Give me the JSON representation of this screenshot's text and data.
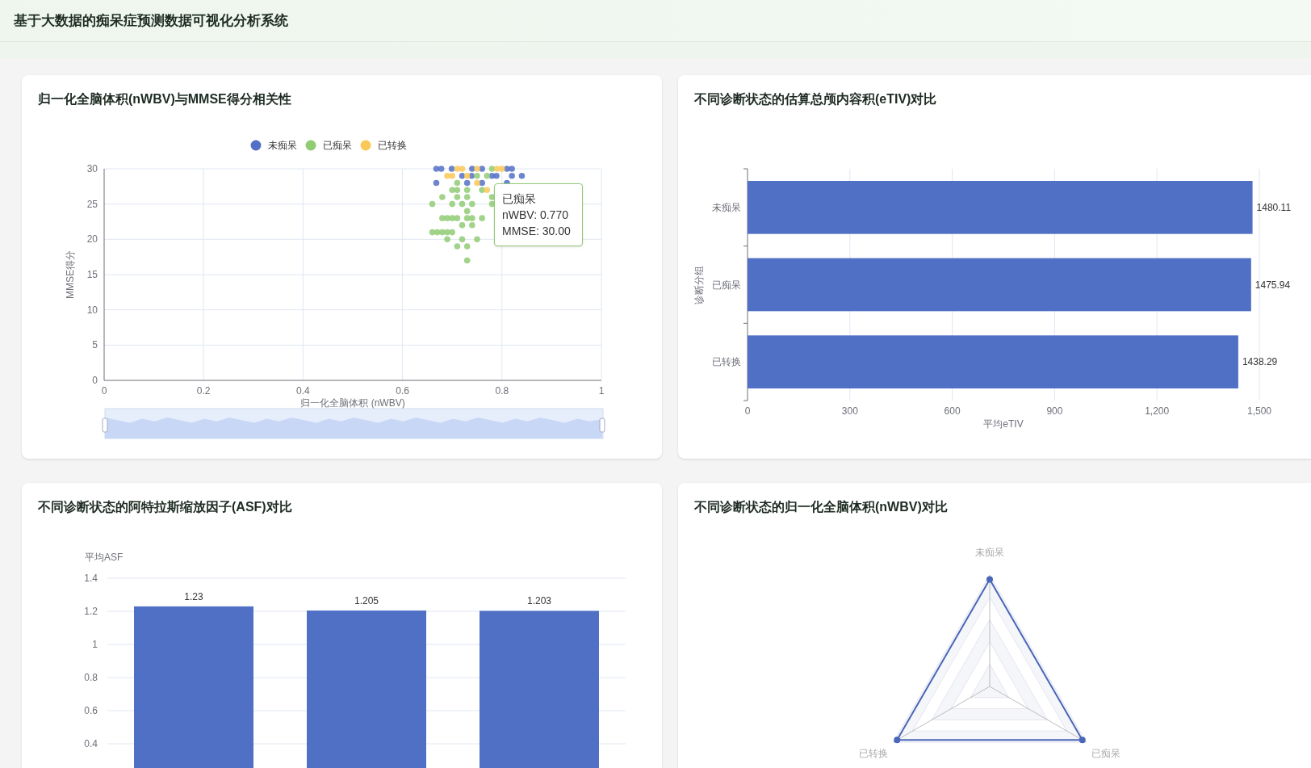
{
  "header": {
    "title": "基于大数据的痴呆症预测数据可视化分析系统"
  },
  "panels": [
    {
      "kind": "chart",
      "title": "归一化全脑体积(nWBV)与MMSE得分相关性",
      "tooltip": {
        "title": "已痴呆",
        "lines": [
          "nWBV: 0.770",
          "MMSE: 30.00"
        ]
      },
      "chart_data": {
        "type": "scatter",
        "grid": true,
        "legend": true,
        "xlabel": "归一化全脑体积 (nWBV)",
        "ylabel": "MMSE得分",
        "xlim": [
          0,
          1
        ],
        "ylim": [
          0,
          30
        ],
        "xticks": [
          0,
          0.2,
          0.4,
          0.6,
          0.8,
          1
        ],
        "yticks": [
          0,
          5,
          10,
          15,
          20,
          25,
          30
        ],
        "series": [
          {
            "name": "未痴呆",
            "color": "#5470c6",
            "x": [
              0.668,
              0.678,
              0.699,
              0.74,
              0.76,
              0.81,
              0.82,
              0.668,
              0.72,
              0.739,
              0.78,
              0.789,
              0.82,
              0.84,
              0.81,
              0.73,
              0.76
            ],
            "values": [
              30,
              30,
              30,
              30,
              30,
              30,
              30,
              28,
              29,
              29,
              29,
              29,
              29,
              29,
              28,
              28,
              28
            ]
          },
          {
            "name": "已痴呆",
            "color": "#91cc75",
            "x": [
              0.66,
              0.68,
              0.7,
              0.71,
              0.72,
              0.73,
              0.74,
              0.73,
              0.68,
              0.69,
              0.7,
              0.71,
              0.73,
              0.74,
              0.76,
              0.72,
              0.74,
              0.66,
              0.67,
              0.68,
              0.69,
              0.7,
              0.69,
              0.72,
              0.75,
              0.71,
              0.73,
              0.73,
              0.7,
              0.71,
              0.73,
              0.76,
              0.78,
              0.78,
              0.71,
              0.75,
              0.77,
              0.78
            ],
            "values": [
              25,
              26,
              25,
              26,
              25,
              26,
              25,
              24,
              23,
              23,
              23,
              23,
              23,
              23,
              23,
              22,
              22,
              21,
              21,
              21,
              21,
              21,
              20,
              20,
              20,
              19,
              19,
              17,
              27,
              27,
              27,
              27,
              26,
              25,
              28,
              29,
              29,
              30
            ]
          },
          {
            "name": "已转换",
            "color": "#fac858",
            "x": [
              0.69,
              0.7,
              0.71,
              0.72,
              0.73,
              0.75,
              0.75,
              0.77,
              0.79,
              0.8
            ],
            "values": [
              29,
              29,
              30,
              30,
              29,
              30,
              28,
              27,
              30,
              30
            ]
          }
        ]
      }
    },
    {
      "kind": "chart",
      "title": "不同诊断状态的估算总颅内容积(eTIV)对比",
      "chart_data": {
        "type": "bar",
        "orientation": "horizontal",
        "grid": true,
        "xlabel": "平均eTIV",
        "ylabel": "诊断分组",
        "categories": [
          "未痴呆",
          "已痴呆",
          "已转换"
        ],
        "values": [
          1480.11,
          1475.94,
          1438.29
        ],
        "xlim": [
          0,
          1500
        ],
        "xticks": [
          {
            "value": 0,
            "label": "0"
          },
          {
            "value": 300,
            "label": "300"
          },
          {
            "value": 600,
            "label": "600"
          },
          {
            "value": 900,
            "label": "900"
          },
          {
            "value": 1200,
            "label": "1,200"
          },
          {
            "value": 1500,
            "label": "1,500"
          }
        ],
        "data_labels": true
      }
    },
    {
      "kind": "chart",
      "title": "不同诊断状态的阿特拉斯缩放因子(ASF)对比",
      "chart_data": {
        "type": "bar",
        "orientation": "vertical",
        "grid": true,
        "ylabel": "平均ASF",
        "values": [
          1.23,
          1.205,
          1.203
        ],
        "ylim": [
          0,
          1.4
        ],
        "yticks": [
          0.4,
          0.6,
          0.8,
          1,
          1.2,
          1.4
        ],
        "data_labels": true
      }
    },
    {
      "kind": "radar",
      "title": "不同诊断状态的归一化全脑体积(nWBV)对比",
      "axes": [
        "未痴呆",
        "已痴呆",
        "已转换"
      ]
    }
  ]
}
